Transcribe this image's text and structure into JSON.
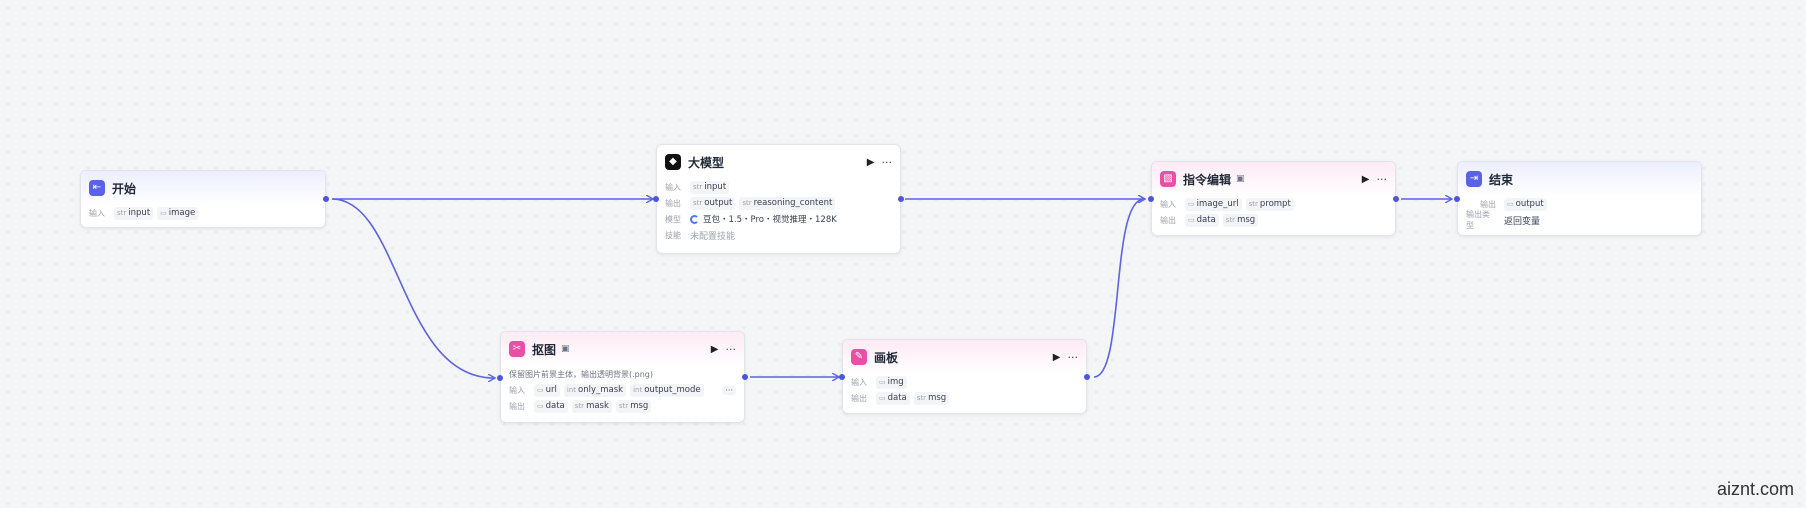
{
  "colors": {
    "accent": "#5a63e8",
    "edge": "#5b63e6",
    "pink": "#ea4fa6"
  },
  "labels": {
    "input": "输入",
    "output": "输出",
    "model": "模型",
    "skill": "技能",
    "output_type": "输出类型"
  },
  "nodes": {
    "start": {
      "title": "开始",
      "icon": "enter-icon",
      "inputs": [
        {
          "type": "str",
          "name": "input"
        },
        {
          "type": "img",
          "name": "image"
        }
      ]
    },
    "llm": {
      "title": "大模型",
      "icon": "llm-icon",
      "inputs": [
        {
          "type": "str",
          "name": "input"
        }
      ],
      "outputs": [
        {
          "type": "str",
          "name": "output"
        },
        {
          "type": "str",
          "name": "reasoning_content"
        }
      ],
      "model": "豆包・1.5・Pro・视觉推理・128K",
      "skill": "未配置技能"
    },
    "cutout": {
      "title": "抠图",
      "icon": "cutout-icon",
      "desc": "保留图片前景主体，输出透明背景(.png)",
      "inputs": [
        {
          "type": "img",
          "name": "url"
        },
        {
          "type": "int",
          "name": "only_mask"
        },
        {
          "type": "int",
          "name": "output_mode"
        }
      ],
      "outputs": [
        {
          "type": "img",
          "name": "data"
        },
        {
          "type": "str",
          "name": "mask"
        },
        {
          "type": "str",
          "name": "msg"
        }
      ]
    },
    "canvas": {
      "title": "画板",
      "icon": "canvas-icon",
      "inputs": [
        {
          "type": "img",
          "name": "img"
        }
      ],
      "outputs": [
        {
          "type": "img",
          "name": "data"
        },
        {
          "type": "str",
          "name": "msg"
        }
      ]
    },
    "edit": {
      "title": "指令编辑",
      "icon": "image-edit-icon",
      "inputs": [
        {
          "type": "img",
          "name": "image_url"
        },
        {
          "type": "str",
          "name": "prompt"
        }
      ],
      "outputs": [
        {
          "type": "img",
          "name": "data"
        },
        {
          "type": "str",
          "name": "msg"
        }
      ]
    },
    "end": {
      "title": "结束",
      "icon": "exit-icon",
      "outputs": [
        {
          "type": "img",
          "name": "output"
        }
      ],
      "output_type": "返回变量"
    }
  },
  "type_glyphs": {
    "str": "str",
    "int": "int",
    "img": "▭"
  },
  "watermark": "aiznt.com"
}
